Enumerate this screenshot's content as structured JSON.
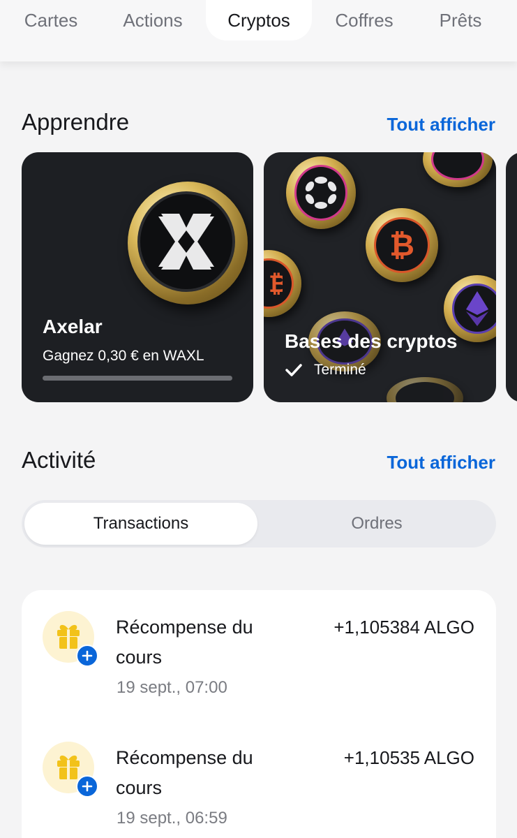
{
  "tabs": [
    {
      "label": "Cartes",
      "active": false
    },
    {
      "label": "Actions",
      "active": false
    },
    {
      "label": "Cryptos",
      "active": true
    },
    {
      "label": "Coffres",
      "active": false
    },
    {
      "label": "Prêts",
      "active": false
    }
  ],
  "learn": {
    "title": "Apprendre",
    "see_all": "Tout afficher",
    "cards": [
      {
        "title": "Axelar",
        "subtitle": "Gagnez 0,30 € en WAXL",
        "progress": 0.0,
        "icon": "axelar-coin"
      },
      {
        "title": "Bases des cryptos",
        "status": "Terminé",
        "icon": "crypto-coins"
      }
    ]
  },
  "activity": {
    "title": "Activité",
    "see_all": "Tout afficher",
    "segments": [
      {
        "label": "Transactions",
        "selected": true
      },
      {
        "label": "Ordres",
        "selected": false
      }
    ],
    "transactions": [
      {
        "title": "Récompense du cours",
        "amount": "+1,105384 ALGO",
        "date": "19 sept., 07:00",
        "icon": "gift-icon"
      },
      {
        "title": "Récompense du cours",
        "amount": "+1,10535 ALGO",
        "date": "19 sept., 06:59",
        "icon": "gift-icon"
      }
    ]
  },
  "colors": {
    "accent": "#0a66d9",
    "background": "#f4f4f5",
    "card_dark": "#1d1f23",
    "gift_bg": "#fdf3d2",
    "gift": "#f2c21a"
  }
}
